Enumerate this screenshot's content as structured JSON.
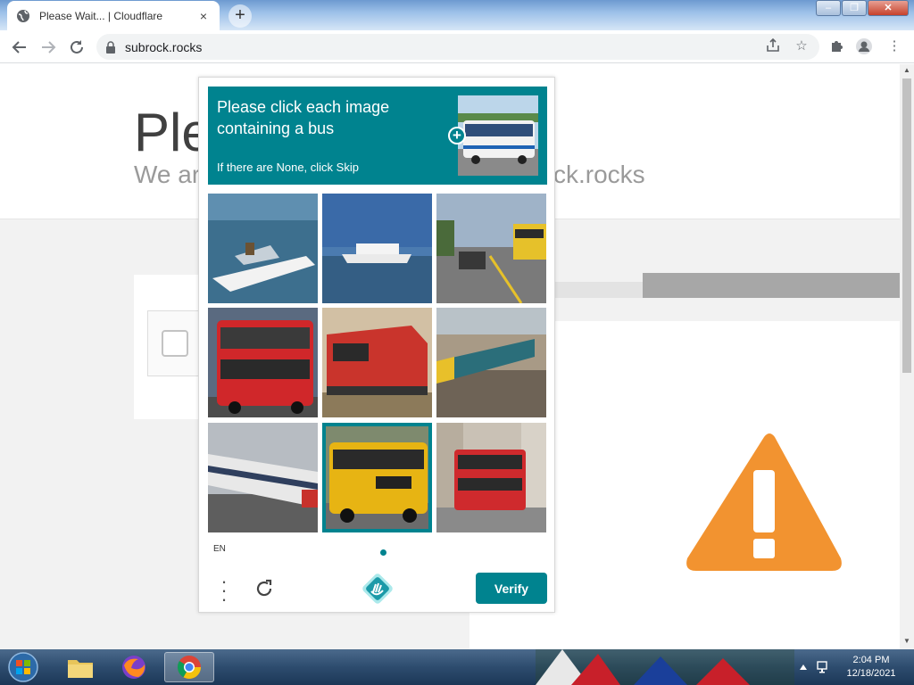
{
  "browser": {
    "tab_title": "Please Wait... | Cloudflare",
    "tab_close": "×",
    "new_tab": "+",
    "url": "subrock.rocks",
    "window_controls": {
      "minimize": "–",
      "restore": "❐",
      "close": "✕"
    },
    "icons": [
      "globe-icon",
      "back-icon",
      "forward-icon",
      "reload-icon",
      "lock-icon",
      "share-icon",
      "star-icon",
      "extensions-icon",
      "profile-icon",
      "menu-icon"
    ]
  },
  "page": {
    "heading_partial": "Ple",
    "subheading_left": "We ar",
    "subheading_right": "ck.rocks"
  },
  "captcha": {
    "prompt_title": "Please click each image containing a bus",
    "prompt_sub": "If there are None, click Skip",
    "language": "EN",
    "verify_label": "Verify",
    "accent_color": "#00838f",
    "tiles": [
      {
        "subject": "speedboat",
        "selected": false
      },
      {
        "subject": "ferry",
        "selected": false
      },
      {
        "subject": "train-station",
        "selected": false
      },
      {
        "subject": "red-double-decker-bus",
        "selected": false
      },
      {
        "subject": "red-locomotive",
        "selected": false
      },
      {
        "subject": "passenger-train",
        "selected": false
      },
      {
        "subject": "white-train",
        "selected": false
      },
      {
        "subject": "yellow-school-bus",
        "selected": true
      },
      {
        "subject": "red-double-decker-bus-street",
        "selected": false
      }
    ]
  },
  "taskbar": {
    "time": "2:04 PM",
    "date": "12/18/2021",
    "apps": [
      "windows-explorer",
      "firefox",
      "chrome"
    ]
  }
}
